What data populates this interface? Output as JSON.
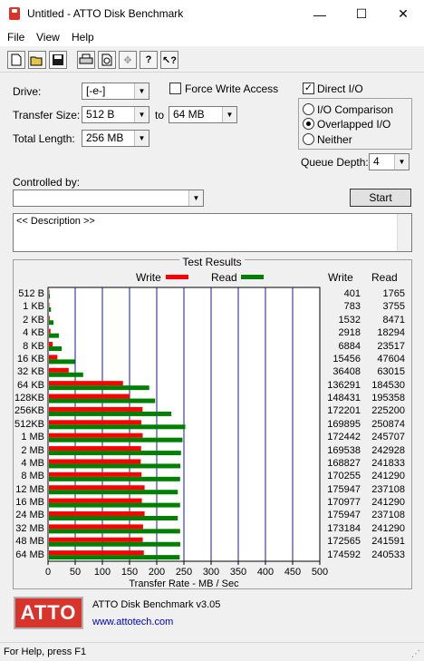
{
  "window": {
    "title": "Untitled - ATTO Disk Benchmark",
    "minimize": "—",
    "maximize": "☐",
    "close": "✕"
  },
  "menu": [
    "File",
    "View",
    "Help"
  ],
  "toolbar": [
    "new-icon",
    "open-icon",
    "save-icon",
    "print-icon",
    "print-preview-icon",
    "move-icon",
    "help-icon",
    "context-help-icon"
  ],
  "form": {
    "drive_label": "Drive:",
    "drive_value": "[-e-]",
    "transfer_size_label": "Transfer Size:",
    "transfer_from": "512 B",
    "to_label": "to",
    "transfer_to": "64 MB",
    "total_length_label": "Total Length:",
    "total_length_value": "256 MB",
    "force_write_label": "Force Write Access",
    "force_write_checked": false,
    "direct_io_label": "Direct I/O",
    "direct_io_checked": true,
    "io_comparison_label": "I/O Comparison",
    "overlapped_io_label": "Overlapped I/O",
    "neither_label": "Neither",
    "selected_mode": "Overlapped I/O",
    "queue_depth_label": "Queue Depth:",
    "queue_depth_value": "4",
    "controlled_by_label": "Controlled by:",
    "controlled_by_value": "",
    "start_label": "Start",
    "description": "<< Description >>"
  },
  "results": {
    "title": "Test Results",
    "legend_write": "Write",
    "legend_read": "Read",
    "col_write": "Write",
    "col_read": "Read",
    "rows": [
      {
        "label": "512 B",
        "write": "401",
        "read": "1765"
      },
      {
        "label": "1 KB",
        "write": "783",
        "read": "3755"
      },
      {
        "label": "2 KB",
        "write": "1532",
        "read": "8471"
      },
      {
        "label": "4 KB",
        "write": "2918",
        "read": "18294"
      },
      {
        "label": "8 KB",
        "write": "6884",
        "read": "23517"
      },
      {
        "label": "16 KB",
        "write": "15456",
        "read": "47604"
      },
      {
        "label": "32 KB",
        "write": "36408",
        "read": "63015"
      },
      {
        "label": "64 KB",
        "write": "136291",
        "read": "184530"
      },
      {
        "label": "128KB",
        "write": "148431",
        "read": "195358"
      },
      {
        "label": "256KB",
        "write": "172201",
        "read": "225200"
      },
      {
        "label": "512KB",
        "write": "169895",
        "read": "250874"
      },
      {
        "label": "1 MB",
        "write": "172442",
        "read": "245707"
      },
      {
        "label": "2 MB",
        "write": "169538",
        "read": "242928"
      },
      {
        "label": "4 MB",
        "write": "168827",
        "read": "241833"
      },
      {
        "label": "8 MB",
        "write": "170255",
        "read": "241290"
      },
      {
        "label": "12 MB",
        "write": "175947",
        "read": "237108"
      },
      {
        "label": "16 MB",
        "write": "170977",
        "read": "241290"
      },
      {
        "label": "24 MB",
        "write": "175947",
        "read": "237108"
      },
      {
        "label": "32 MB",
        "write": "173184",
        "read": "241290"
      },
      {
        "label": "48 MB",
        "write": "172565",
        "read": "241591"
      },
      {
        "label": "64 MB",
        "write": "174592",
        "read": "240533"
      }
    ]
  },
  "chart_data": {
    "type": "bar",
    "xlabel": "Transfer Rate - MB / Sec",
    "xlim": [
      0,
      500
    ],
    "ticks": [
      "0",
      "50",
      "100",
      "150",
      "200",
      "250",
      "300",
      "350",
      "400",
      "450",
      "500"
    ],
    "categories": [
      "512 B",
      "1 KB",
      "2 KB",
      "4 KB",
      "8 KB",
      "16 KB",
      "32 KB",
      "64 KB",
      "128KB",
      "256KB",
      "512KB",
      "1 MB",
      "2 MB",
      "4 MB",
      "8 MB",
      "12 MB",
      "16 MB",
      "24 MB",
      "32 MB",
      "48 MB",
      "64 MB"
    ],
    "series": [
      {
        "name": "Write",
        "color": "#ff0000",
        "values": [
          0.4,
          0.78,
          1.53,
          2.92,
          6.88,
          15.46,
          36.41,
          136.29,
          148.43,
          172.2,
          169.9,
          172.44,
          169.54,
          168.83,
          170.26,
          175.95,
          170.98,
          175.95,
          173.18,
          172.57,
          174.59
        ]
      },
      {
        "name": "Read",
        "color": "#008000",
        "values": [
          1.77,
          3.76,
          8.47,
          18.29,
          23.52,
          47.6,
          63.02,
          184.53,
          195.36,
          225.2,
          250.87,
          245.71,
          242.93,
          241.83,
          241.29,
          237.11,
          241.29,
          237.11,
          241.29,
          241.59,
          240.53
        ]
      }
    ],
    "grid": true,
    "legend": "top"
  },
  "footer": {
    "logo_text": "ATTO",
    "product": "ATTO Disk Benchmark v3.05",
    "link": "www.attotech.com"
  },
  "status": "For Help, press F1"
}
